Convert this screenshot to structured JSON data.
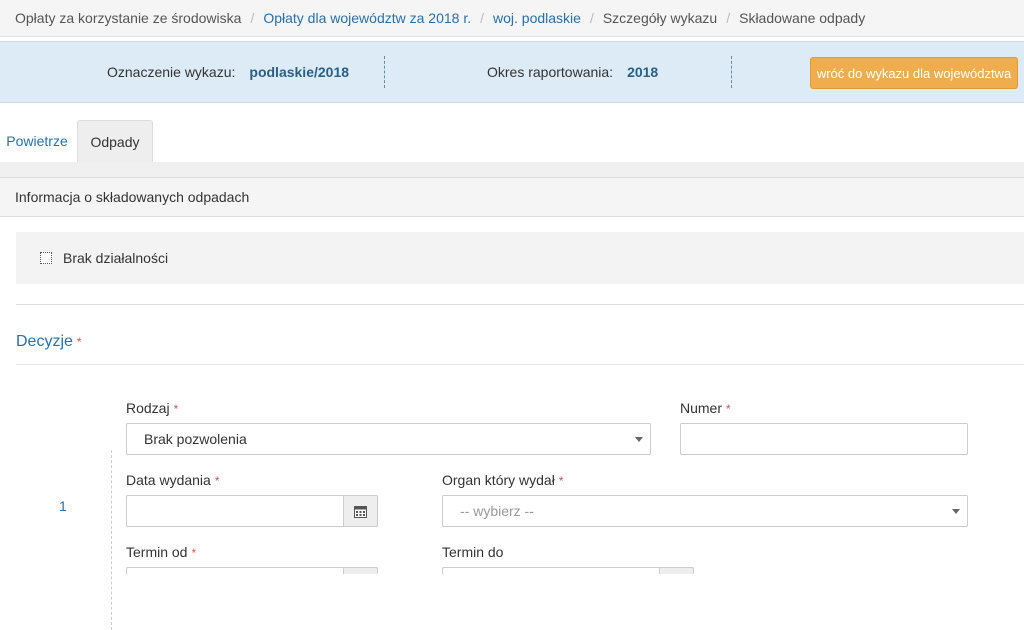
{
  "breadcrumb": {
    "items": [
      {
        "label": "Opłaty za korzystanie ze środowiska",
        "link": false
      },
      {
        "label": "Opłaty dla województw za 2018 r.",
        "link": true
      },
      {
        "label": "woj. podlaskie",
        "link": true
      },
      {
        "label": "Szczegóły wykazu",
        "link": false
      },
      {
        "label": "Składowane odpady",
        "link": false
      }
    ],
    "separator": "/"
  },
  "infobar": {
    "designation_label": "Oznaczenie wykazu:",
    "designation_value": "podlaskie/2018",
    "period_label": "Okres raportowania:",
    "period_value": "2018",
    "back_button": "wróć do wykazu dla województwa"
  },
  "tabs": [
    {
      "label": "Powietrze",
      "active": false
    },
    {
      "label": "Odpady",
      "active": true
    }
  ],
  "panel": {
    "title": "Informacja o składowanych odpadach",
    "no_activity_label": "Brak działalności",
    "no_activity_checked": false
  },
  "decisions": {
    "title": "Decyzje",
    "required_mark": "*",
    "row_index": "1",
    "rodzaj_label": "Rodzaj",
    "rodzaj_value": "Brak pozwolenia",
    "numer_label": "Numer",
    "numer_value": "",
    "data_wydania_label": "Data wydania",
    "data_wydania_value": "",
    "organ_label": "Organ który wydał",
    "organ_placeholder": "-- wybierz --",
    "termin_od_label": "Termin od",
    "termin_do_label": "Termin do"
  },
  "colors": {
    "link": "#2a6fa8",
    "required": "#d9534f",
    "back_button": "#f0ad4e",
    "infobar": "#dcebf5"
  },
  "icons": {
    "calendar": "calendar-icon",
    "dropdown": "chevron-down-icon",
    "checkbox": "checkbox-icon"
  }
}
